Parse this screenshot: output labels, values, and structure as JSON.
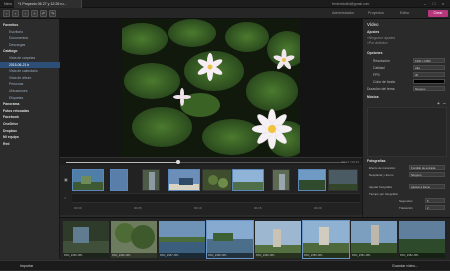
{
  "app": {
    "name": "Nero"
  },
  "window_tab": {
    "title": "*1 Proyecto 06 27 y 12:26 ru..."
  },
  "account": {
    "email": "frederickdkd@gmail.com"
  },
  "toolbar": {
    "tabs": [
      "Administrador",
      "Proyectos",
      "Editor"
    ],
    "create_label": "Crear"
  },
  "sidebar": {
    "items": [
      {
        "label": "Favoritos",
        "level": "h"
      },
      {
        "label": "Escritorio",
        "level": "s"
      },
      {
        "label": "Documentos",
        "level": "s"
      },
      {
        "label": "Descargas",
        "level": "s"
      },
      {
        "label": "Catálogo",
        "level": "h"
      },
      {
        "label": "Vista de carpetas",
        "level": "s"
      },
      {
        "label": "2015-06-21 b",
        "level": "sel"
      },
      {
        "label": "Vista de calendario",
        "level": "s"
      },
      {
        "label": "Vista de álbum",
        "level": "s"
      },
      {
        "label": "Personas",
        "level": "s"
      },
      {
        "label": "Ubicaciones",
        "level": "s"
      },
      {
        "label": "Etiquetas",
        "level": "s"
      },
      {
        "label": "Panorama",
        "level": "h"
      },
      {
        "label": "Fotos retocadas",
        "level": "h"
      },
      {
        "label": "Facebook",
        "level": "h"
      },
      {
        "label": "OneDrive",
        "level": "h"
      },
      {
        "label": "Dropbox",
        "level": "h"
      },
      {
        "label": "Mi equipo",
        "level": "h"
      },
      {
        "label": "Red",
        "level": "h"
      }
    ]
  },
  "player": {
    "timecode": "00:14 / 00:24"
  },
  "timeline": {
    "ruler": [
      "00:00",
      "00:05",
      "00:10",
      "00:15",
      "00:20"
    ]
  },
  "right_panel": {
    "title": "Vídeo",
    "ajustes": "Ajustes",
    "ajustes_sub1": "«Ninguno» ajustes",
    "ajustes_sub2": "«Por defecto»",
    "opciones": "Opciones",
    "resolucion_label": "Resolución",
    "resolucion_value": "1920 x 1080",
    "calidad_label": "Calidad",
    "calidad_value": "Alta",
    "fps_label": "FPS",
    "fps_value": "30",
    "fondo_label": "Color de fondo",
    "fondo_value": "#000000",
    "duracion_label": "Duración del tema",
    "duracion_value": "Ninguno",
    "musica": "Música",
    "fotografias": "Fotografías",
    "efecto_label": "Efecto de transición",
    "efecto_value": "Fundido de entrada",
    "desplazar_label": "Desplazar y Zoom",
    "desplazar_value": "Ninguno",
    "ajustar_label": "Ajustar fotografía",
    "ajustar_value": "Ajustar a frame",
    "tiempo_label": "Tiempo por fotografía",
    "segundos_label": "Segundos",
    "segundos_value": "5",
    "transicion_label": "Transición",
    "transicion_value": "2"
  },
  "strip": {
    "items": [
      {
        "caption": "DSC_2345.JPG"
      },
      {
        "caption": "DSC_2346.JPG"
      },
      {
        "caption": "DSC_2347.JPG"
      },
      {
        "caption": "DSC_2348.JPG"
      },
      {
        "caption": "DSC_2349.JPG"
      },
      {
        "caption": "DSC_2350.JPG"
      },
      {
        "caption": "DSC_2351.JPG"
      },
      {
        "caption": "DSC_2352.JPG"
      }
    ]
  },
  "bottom": {
    "import_label": "Importar",
    "save_label": "Guardar vídeo..."
  }
}
